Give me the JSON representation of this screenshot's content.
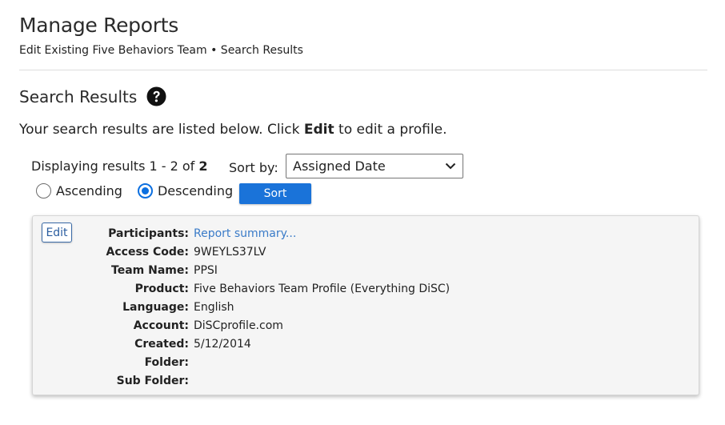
{
  "header": {
    "title": "Manage Reports",
    "breadcrumb": "Edit Existing Five Behaviors Team • Search Results"
  },
  "section": {
    "title": "Search Results",
    "help_icon": "question-circle-icon"
  },
  "intro": {
    "prefix": "Your search results are listed below. Click ",
    "bold": "Edit",
    "suffix": " to edit a profile."
  },
  "results": {
    "display_prefix": "Displaying results 1 - 2 of ",
    "total": "2"
  },
  "sort": {
    "label": "Sort by:",
    "selected": "Assigned Date",
    "ascending_label": "Ascending",
    "descending_label": "Descending",
    "selected_order": "Descending",
    "button_label": "Sort"
  },
  "record": {
    "edit_label": "Edit",
    "fields": [
      {
        "label": "Participants:",
        "value": "Report summary...",
        "link": true
      },
      {
        "label": "Access Code:",
        "value": "9WEYLS37LV"
      },
      {
        "label": "Team Name:",
        "value": "PPSI"
      },
      {
        "label": "Product:",
        "value": "Five Behaviors Team Profile (Everything DiSC)"
      },
      {
        "label": "Language:",
        "value": "English"
      },
      {
        "label": "Account:",
        "value": "DiSCprofile.com"
      },
      {
        "label": "Created:",
        "value": "5/12/2014"
      },
      {
        "label": "Folder:",
        "value": ""
      },
      {
        "label": "Sub Folder:",
        "value": ""
      }
    ]
  },
  "colors": {
    "primary_button": "#1a73d9",
    "link": "#3a7bc8",
    "radio_checked": "#0b6fe0"
  }
}
